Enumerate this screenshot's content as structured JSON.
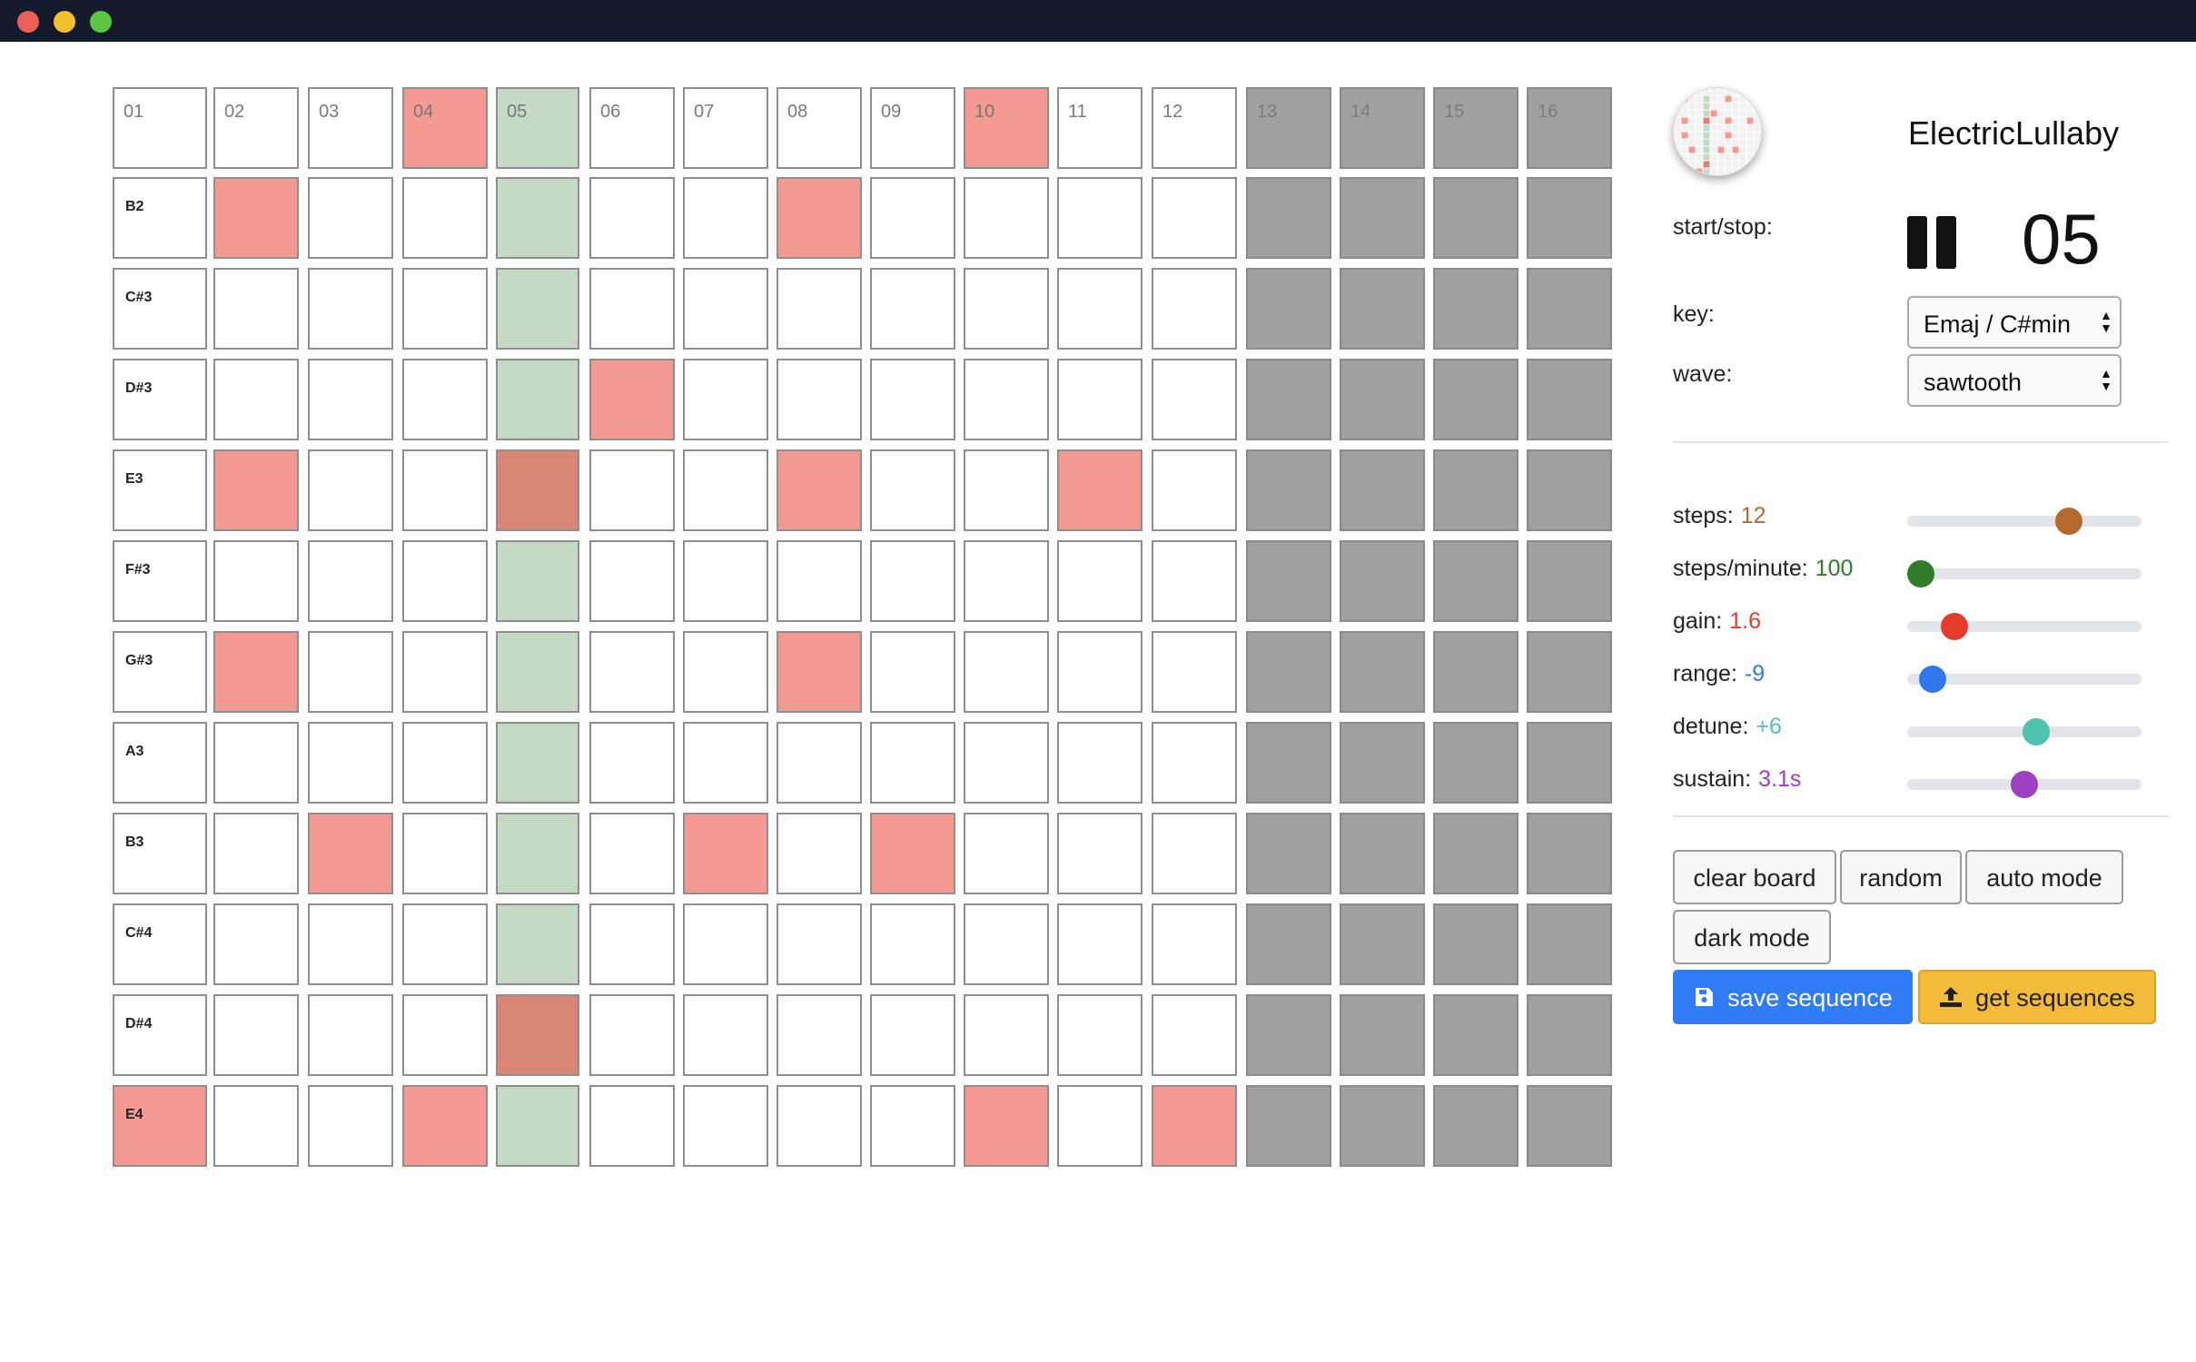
{
  "window": {
    "title_bar": ""
  },
  "grid": {
    "step_headers": [
      "01",
      "02",
      "03",
      "04",
      "05",
      "06",
      "07",
      "08",
      "09",
      "10",
      "11",
      "12",
      "13",
      "14",
      "15",
      "16"
    ],
    "notes": [
      "B2",
      "C#3",
      "D#3",
      "E3",
      "F#3",
      "G#3",
      "A3",
      "B3",
      "C#4",
      "D#4",
      "E4"
    ],
    "active_steps": 12,
    "current_step": 5,
    "header_on_steps": [
      4,
      10
    ],
    "active_cells": {
      "B2": [
        2,
        8
      ],
      "C#3": [],
      "D#3": [
        6
      ],
      "E3": [
        2,
        5,
        8,
        11
      ],
      "F#3": [],
      "G#3": [
        2,
        8
      ],
      "A3": [],
      "B3": [
        3,
        7,
        9
      ],
      "C#4": [],
      "D#4": [
        5
      ],
      "E4": [
        1,
        4,
        10,
        12
      ]
    }
  },
  "panel": {
    "title": "ElectricLullaby",
    "logo_icon": "sequence-thumbnail-icon",
    "start_stop_label": "start/stop:",
    "play_icon": "pause-icon",
    "current_step_display": "05",
    "key_label": "key:",
    "key_value": "Emaj / C#min",
    "wave_label": "wave:",
    "wave_value": "sawtooth",
    "sliders": [
      {
        "id": "steps",
        "label": "steps:",
        "value": "12",
        "color": "#b5692e",
        "level": 0.69
      },
      {
        "id": "steps-per-minute",
        "label": "steps/minute:",
        "value": "100",
        "color": "#2f7d2a",
        "level": 0.06
      },
      {
        "id": "gain",
        "label": "gain:",
        "value": "1.6",
        "color": "#e33b2e",
        "level": 0.2
      },
      {
        "id": "range",
        "label": "range:",
        "value": "-9",
        "color": "#2f78f0",
        "level": 0.11
      },
      {
        "id": "detune",
        "label": "detune:",
        "value": "+6",
        "color": "#4fc3ad",
        "level": 0.55
      },
      {
        "id": "sustain",
        "label": "sustain:",
        "value": "3.1s",
        "color": "#9d3fbf",
        "level": 0.5
      }
    ],
    "buttons": {
      "clear_board": "clear board",
      "random": "random",
      "auto_mode": "auto mode",
      "dark_mode": "dark mode",
      "save_sequence": "save sequence",
      "get_sequences": "get sequences"
    },
    "save_icon": "floppy-disk-icon",
    "get_icon": "upload-icon"
  },
  "colors": {
    "cell_on": "#f59a93",
    "cell_current": "#c5d9c4",
    "cell_current_on": "#d88676",
    "cell_disabled": "#a0a0a0",
    "primary": "#2f7cf6",
    "warning": "#f4bb3a"
  }
}
